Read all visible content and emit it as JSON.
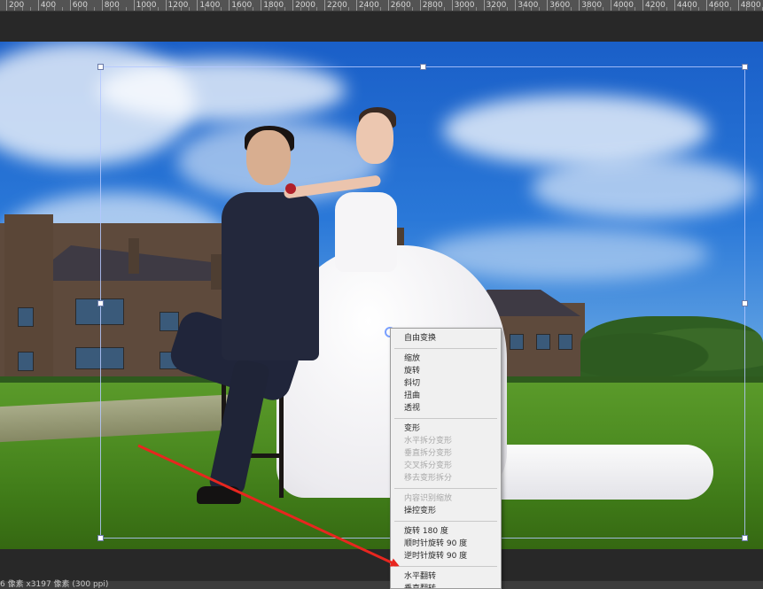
{
  "ruler": {
    "labels": [
      "200",
      "400",
      "600",
      "800",
      "1000",
      "1200",
      "1400",
      "1600",
      "1800",
      "2000",
      "2200",
      "2400",
      "2600",
      "2800",
      "3000",
      "3200",
      "3400",
      "3600",
      "3800",
      "4000",
      "4200",
      "4400",
      "4600",
      "4800"
    ]
  },
  "status": {
    "text": "6 像素 x3197 像素 (300 ppi)"
  },
  "context_menu": {
    "groups": [
      [
        {
          "label": "自由变换",
          "enabled": true
        }
      ],
      [
        {
          "label": "缩放",
          "enabled": true
        },
        {
          "label": "旋转",
          "enabled": true
        },
        {
          "label": "斜切",
          "enabled": true
        },
        {
          "label": "扭曲",
          "enabled": true
        },
        {
          "label": "透视",
          "enabled": true
        }
      ],
      [
        {
          "label": "变形",
          "enabled": true
        },
        {
          "label": "水平拆分变形",
          "enabled": false
        },
        {
          "label": "垂直拆分变形",
          "enabled": false
        },
        {
          "label": "交叉拆分变形",
          "enabled": false
        },
        {
          "label": "移去变形拆分",
          "enabled": false
        }
      ],
      [
        {
          "label": "内容识别缩放",
          "enabled": false
        },
        {
          "label": "操控变形",
          "enabled": true
        }
      ],
      [
        {
          "label": "旋转 180 度",
          "enabled": true
        },
        {
          "label": "顺时针旋转 90 度",
          "enabled": true
        },
        {
          "label": "逆时针旋转 90 度",
          "enabled": true
        }
      ],
      [
        {
          "label": "水平翻转",
          "enabled": true
        },
        {
          "label": "垂直翻转",
          "enabled": true
        }
      ]
    ]
  },
  "colors": {
    "annotation_arrow": "#e8261f",
    "menu_bg": "#f0f0f0",
    "workspace_bg": "#282828"
  },
  "icons": {
    "pivot": "transform-reference-point-icon"
  }
}
